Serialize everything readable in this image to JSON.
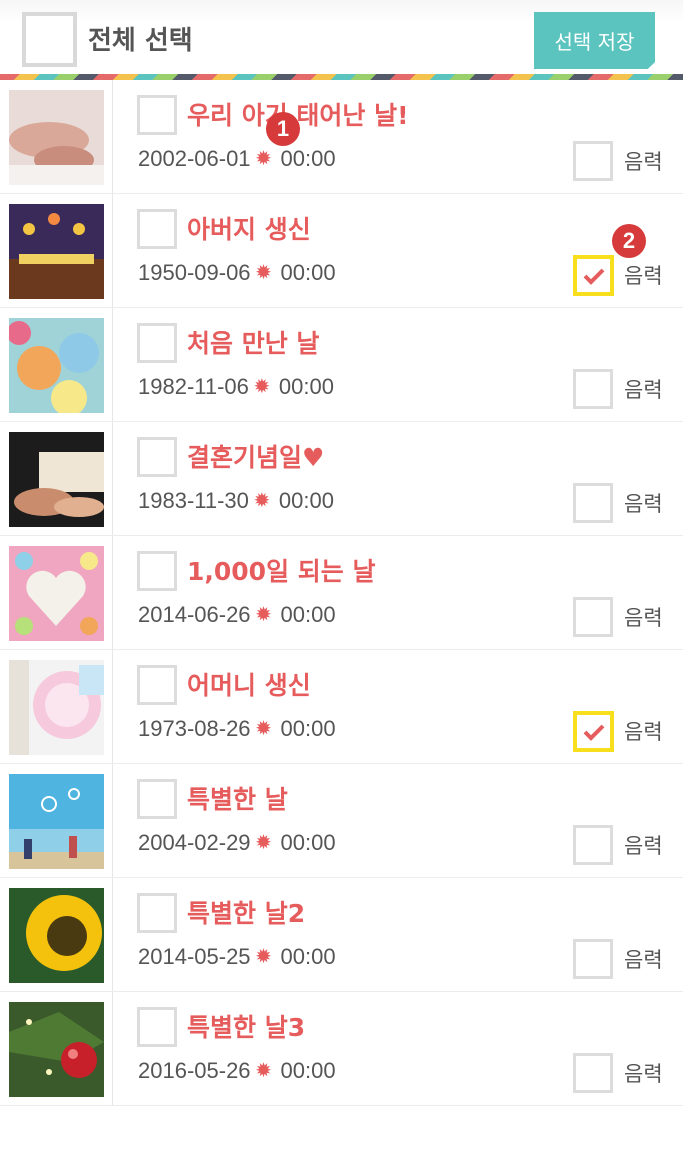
{
  "header": {
    "select_all_label": "전체 선택",
    "save_button_label": "선택 저장"
  },
  "markers": [
    "1",
    "2"
  ],
  "lunar_label": "음력",
  "rows": [
    {
      "title": "우리 아기 태어난 날!",
      "date": "2002-06-01",
      "time": "00:00",
      "lunar": false,
      "image": "baby-hand-photo"
    },
    {
      "title": "아버지 생신",
      "date": "1950-09-06",
      "time": "00:00",
      "lunar": true,
      "image": "birthday-cake-photo"
    },
    {
      "title": "처음 만난 날",
      "date": "1982-11-06",
      "time": "00:00",
      "lunar": false,
      "image": "candy-hearts-photo"
    },
    {
      "title": "결혼기념일♥",
      "date": "1983-11-30",
      "time": "00:00",
      "lunar": false,
      "image": "wedding-hands-photo"
    },
    {
      "title": "1,000일 되는 날",
      "date": "2014-06-26",
      "time": "00:00",
      "lunar": false,
      "image": "candy-heart-frame-photo"
    },
    {
      "title": "어머니 생신",
      "date": "1973-08-26",
      "time": "00:00",
      "lunar": true,
      "image": "birthday-balloon-photo"
    },
    {
      "title": "특별한 날",
      "date": "2004-02-29",
      "time": "00:00",
      "lunar": false,
      "image": "beach-bubbles-photo"
    },
    {
      "title": "특별한 날2",
      "date": "2014-05-25",
      "time": "00:00",
      "lunar": false,
      "image": "sunflower-photo"
    },
    {
      "title": "특별한 날3",
      "date": "2016-05-26",
      "time": "00:00",
      "lunar": false,
      "image": "christmas-ornament-photo"
    }
  ],
  "colors": {
    "accent_red": "#e65c5c",
    "save_button": "#5bc4bf",
    "lunar_checked_border": "#f7df1e"
  }
}
